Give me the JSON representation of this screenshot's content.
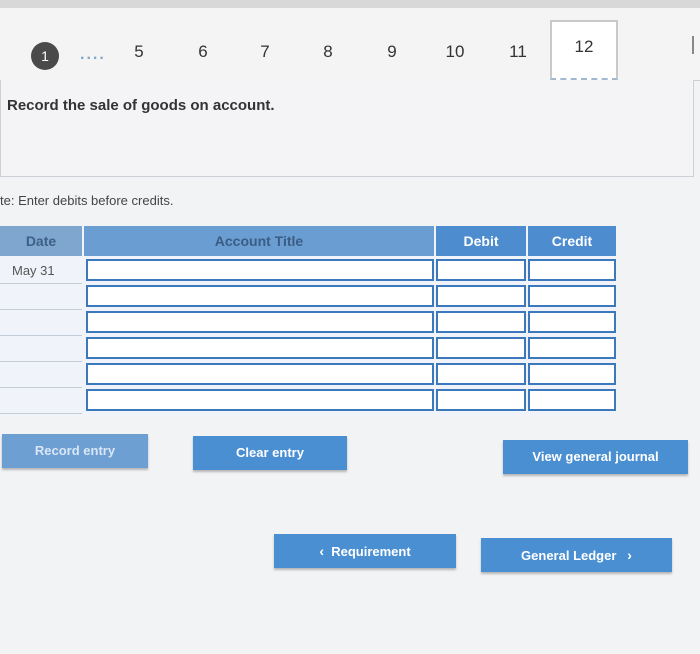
{
  "tabs": {
    "first": "1",
    "ellipsis": "....",
    "numbers": [
      "5",
      "6",
      "7",
      "8",
      "9",
      "10",
      "11"
    ],
    "active": "12"
  },
  "instruction": "Record the sale of goods on account.",
  "note": "te: Enter debits before credits.",
  "journal": {
    "headers": {
      "date": "Date",
      "title": "Account Title",
      "debit": "Debit",
      "credit": "Credit"
    },
    "rows": [
      {
        "date": "May 31"
      },
      {
        "date": ""
      },
      {
        "date": ""
      },
      {
        "date": ""
      },
      {
        "date": ""
      },
      {
        "date": ""
      }
    ]
  },
  "buttons": {
    "record": "Record entry",
    "clear": "Clear entry",
    "view": "View general journal",
    "requirement": "Requirement",
    "ledger": "General Ledger"
  },
  "colors": {
    "accent": "#4b8fd3",
    "header": "#4d8ccf"
  }
}
